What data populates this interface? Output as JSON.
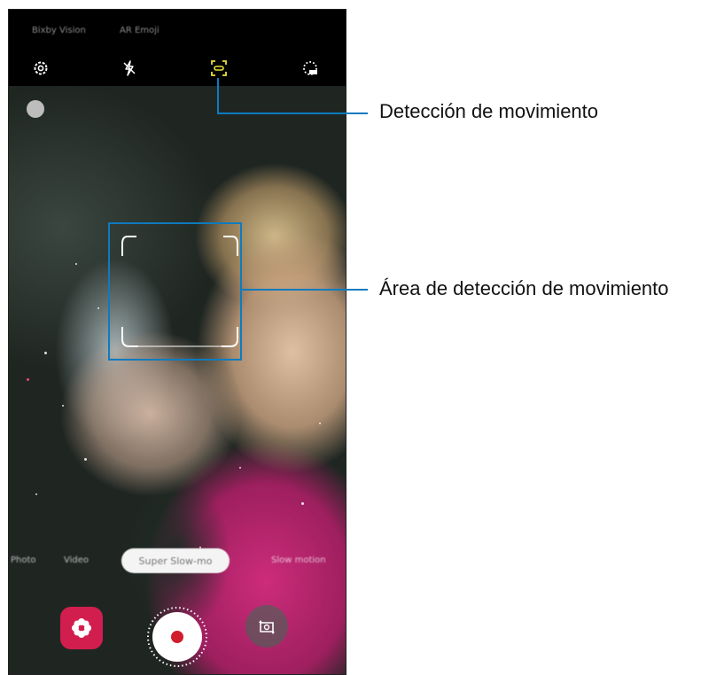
{
  "camera": {
    "top_modes": [
      "Bixby Vision",
      "AR Emoji"
    ],
    "top_icons": [
      "settings-gear-icon",
      "flash-off-icon",
      "motion-detection-icon",
      "slow-motion-timer-icon"
    ],
    "modes": [
      "Photo",
      "Video",
      "Super Slow-mo",
      "Slow motion"
    ],
    "selected_mode": "Super Slow-mo",
    "accent_color": "#e6e03a",
    "record_color": "#d11e2c",
    "gallery_color": "#d11e4e"
  },
  "annotations": {
    "motion_detection_label": "Detección de movimiento",
    "detection_area_label": "Área de detección de movimiento",
    "callout_color": "#0d7bbf"
  }
}
